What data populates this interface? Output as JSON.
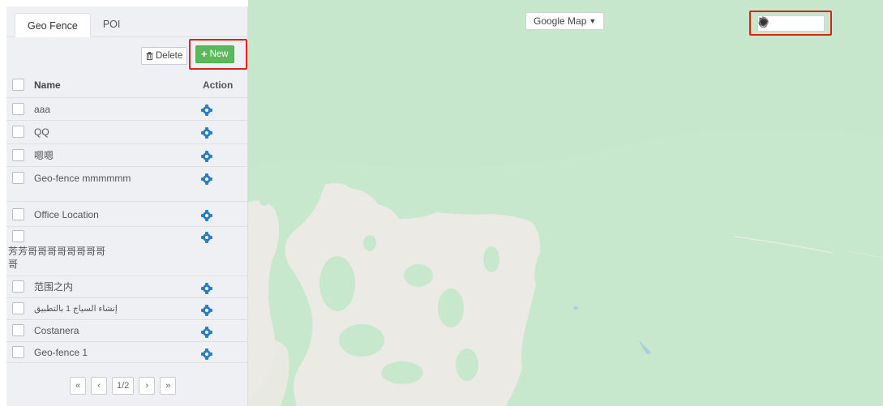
{
  "tabs": [
    {
      "label": "Geo Fence",
      "active": true
    },
    {
      "label": "POI",
      "active": false
    }
  ],
  "toolbar": {
    "delete_label": "Delete",
    "new_label": "New",
    "delete_icon": "trash-icon",
    "new_icon": "plus-icon"
  },
  "table": {
    "headers": {
      "name": "Name",
      "action": "Action"
    },
    "rows": [
      {
        "name": "aaa"
      },
      {
        "name": "QQ"
      },
      {
        "name": "嗯嗯"
      },
      {
        "name": "Geo-fence mmmmmm"
      },
      {
        "name": "Office Location"
      },
      {
        "name": "芳芳哥哥哥哥哥哥哥哥哥"
      },
      {
        "name": "范围之内"
      },
      {
        "name": "إنشاء السياج 1 بالتطبيق"
      },
      {
        "name": "Costanera"
      },
      {
        "name": "Geo-fence 1"
      }
    ]
  },
  "pagination": {
    "first": "«",
    "prev": "‹",
    "page": "1/2",
    "next": "›",
    "last": "»"
  },
  "map": {
    "type_label": "Google Map",
    "tools": [
      "hand-icon",
      "circle-icon",
      "polygon-icon"
    ]
  },
  "colors": {
    "accent_new": "#5cb85c",
    "highlight": "#e0211a",
    "action_icon": "#2a7ec6",
    "map_green": "#c7e8cc",
    "map_land": "#ebeae4"
  }
}
